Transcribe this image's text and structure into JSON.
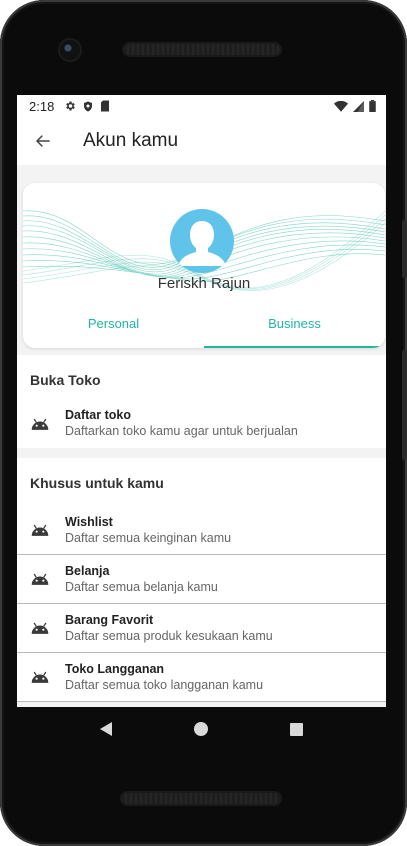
{
  "status": {
    "time": "2:18",
    "left_icons": [
      "gear-icon",
      "shield-icon",
      "sd-card-icon"
    ],
    "right_icons": [
      "wifi-icon",
      "signal-icon",
      "battery-icon"
    ]
  },
  "appbar": {
    "back_icon": "arrow-left-icon",
    "title": "Akun kamu"
  },
  "profile": {
    "name": "Feriskh Rajun",
    "avatar_color": "#5fc3ea",
    "wave_color": "#22b5a0"
  },
  "tabs": [
    {
      "label": "Personal",
      "active": false
    },
    {
      "label": "Business",
      "active": true
    }
  ],
  "sections": [
    {
      "title": "Buka Toko",
      "items": [
        {
          "icon": "android-icon",
          "title": "Daftar toko",
          "subtitle": "Daftarkan toko kamu agar untuk berjualan"
        }
      ]
    },
    {
      "title": "Khusus untuk kamu",
      "items": [
        {
          "icon": "android-icon",
          "title": "Wishlist",
          "subtitle": "Daftar semua keinginan kamu"
        },
        {
          "icon": "android-icon",
          "title": "Belanja",
          "subtitle": "Daftar semua belanja kamu"
        },
        {
          "icon": "android-icon",
          "title": "Barang Favorit",
          "subtitle": "Daftar semua produk kesukaan kamu"
        },
        {
          "icon": "android-icon",
          "title": "Toko Langganan",
          "subtitle": "Daftar semua toko langganan kamu"
        }
      ]
    }
  ],
  "colors": {
    "accent": "#22b5a0",
    "divider": "#b9b9b9",
    "background": "#f3f3f3"
  },
  "navbar": {
    "icons": [
      "back-triangle-icon",
      "home-circle-icon",
      "recents-square-icon"
    ]
  }
}
